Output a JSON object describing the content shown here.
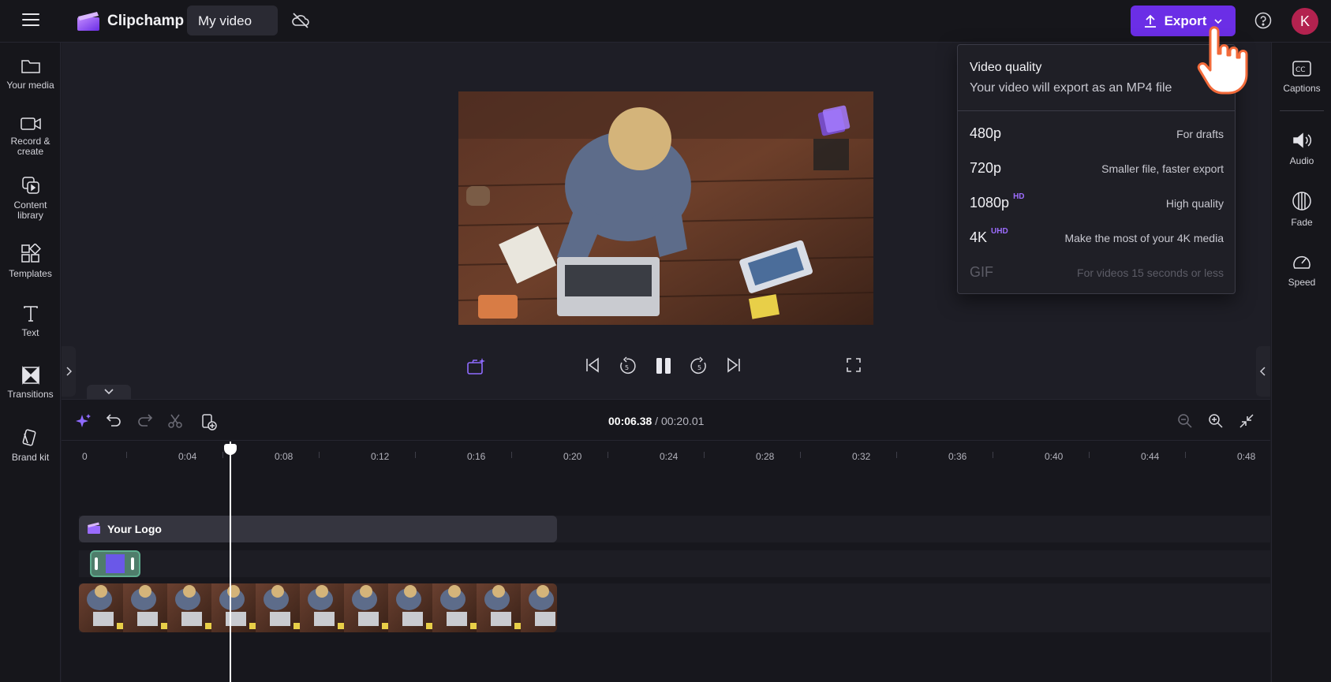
{
  "app": {
    "name": "Clipchamp",
    "project_title": "My video"
  },
  "header": {
    "export_label": "Export",
    "avatar_initial": "K"
  },
  "left_sidebar": {
    "items": [
      {
        "label": "Your media",
        "icon": "folder-icon"
      },
      {
        "label": "Record &\ncreate",
        "icon": "camera-icon"
      },
      {
        "label": "Content\nlibrary",
        "icon": "library-icon"
      },
      {
        "label": "Templates",
        "icon": "templates-icon"
      },
      {
        "label": "Text",
        "icon": "text-icon"
      },
      {
        "label": "Transitions",
        "icon": "transitions-icon"
      },
      {
        "label": "Brand kit",
        "icon": "brand-kit-icon"
      }
    ]
  },
  "right_sidebar": {
    "items": [
      {
        "label": "Captions",
        "icon": "captions-icon"
      },
      {
        "label": "Audio",
        "icon": "speaker-icon"
      },
      {
        "label": "Fade",
        "icon": "fade-icon"
      },
      {
        "label": "Speed",
        "icon": "speedometer-icon"
      }
    ]
  },
  "export_menu": {
    "title": "Video quality",
    "subtitle": "Your video will export as an MP4 file",
    "options": [
      {
        "quality": "480p",
        "badge": "",
        "description": "For drafts",
        "enabled": true
      },
      {
        "quality": "720p",
        "badge": "",
        "description": "Smaller file, faster export",
        "enabled": true
      },
      {
        "quality": "1080p",
        "badge": "HD",
        "description": "High quality",
        "enabled": true
      },
      {
        "quality": "4K",
        "badge": "UHD",
        "description": "Make the most of your 4K media",
        "enabled": true
      },
      {
        "quality": "GIF",
        "badge": "",
        "description": "For videos 15 seconds or less",
        "enabled": false
      }
    ]
  },
  "timeline": {
    "current_time": "00:06.38",
    "separator": " / ",
    "total_time": "00:20.01",
    "ruler_labels": [
      "0",
      "0:04",
      "0:08",
      "0:12",
      "0:16",
      "0:20",
      "0:24",
      "0:28",
      "0:32",
      "0:36",
      "0:40",
      "0:44",
      "0:48"
    ],
    "logo_clip_label": "Your Logo"
  },
  "colors": {
    "accent": "#6b2ee6",
    "hd_badge": "#9d6dff",
    "avatar": "#b3224f"
  }
}
